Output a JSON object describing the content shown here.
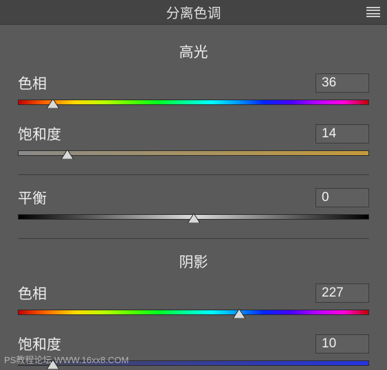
{
  "panel": {
    "title": "分离色调"
  },
  "highlights": {
    "title": "高光",
    "hue": {
      "label": "色相",
      "value": "36",
      "percent": 10
    },
    "saturation": {
      "label": "饱和度",
      "value": "14",
      "percent": 14
    }
  },
  "balance": {
    "label": "平衡",
    "value": "0",
    "percent": 50
  },
  "shadows": {
    "title": "阴影",
    "hue": {
      "label": "色相",
      "value": "227",
      "percent": 63
    },
    "saturation": {
      "label": "饱和度",
      "value": "10",
      "percent": 10
    }
  },
  "watermark": "PS教程论坛 WWW.16xx8.COM"
}
